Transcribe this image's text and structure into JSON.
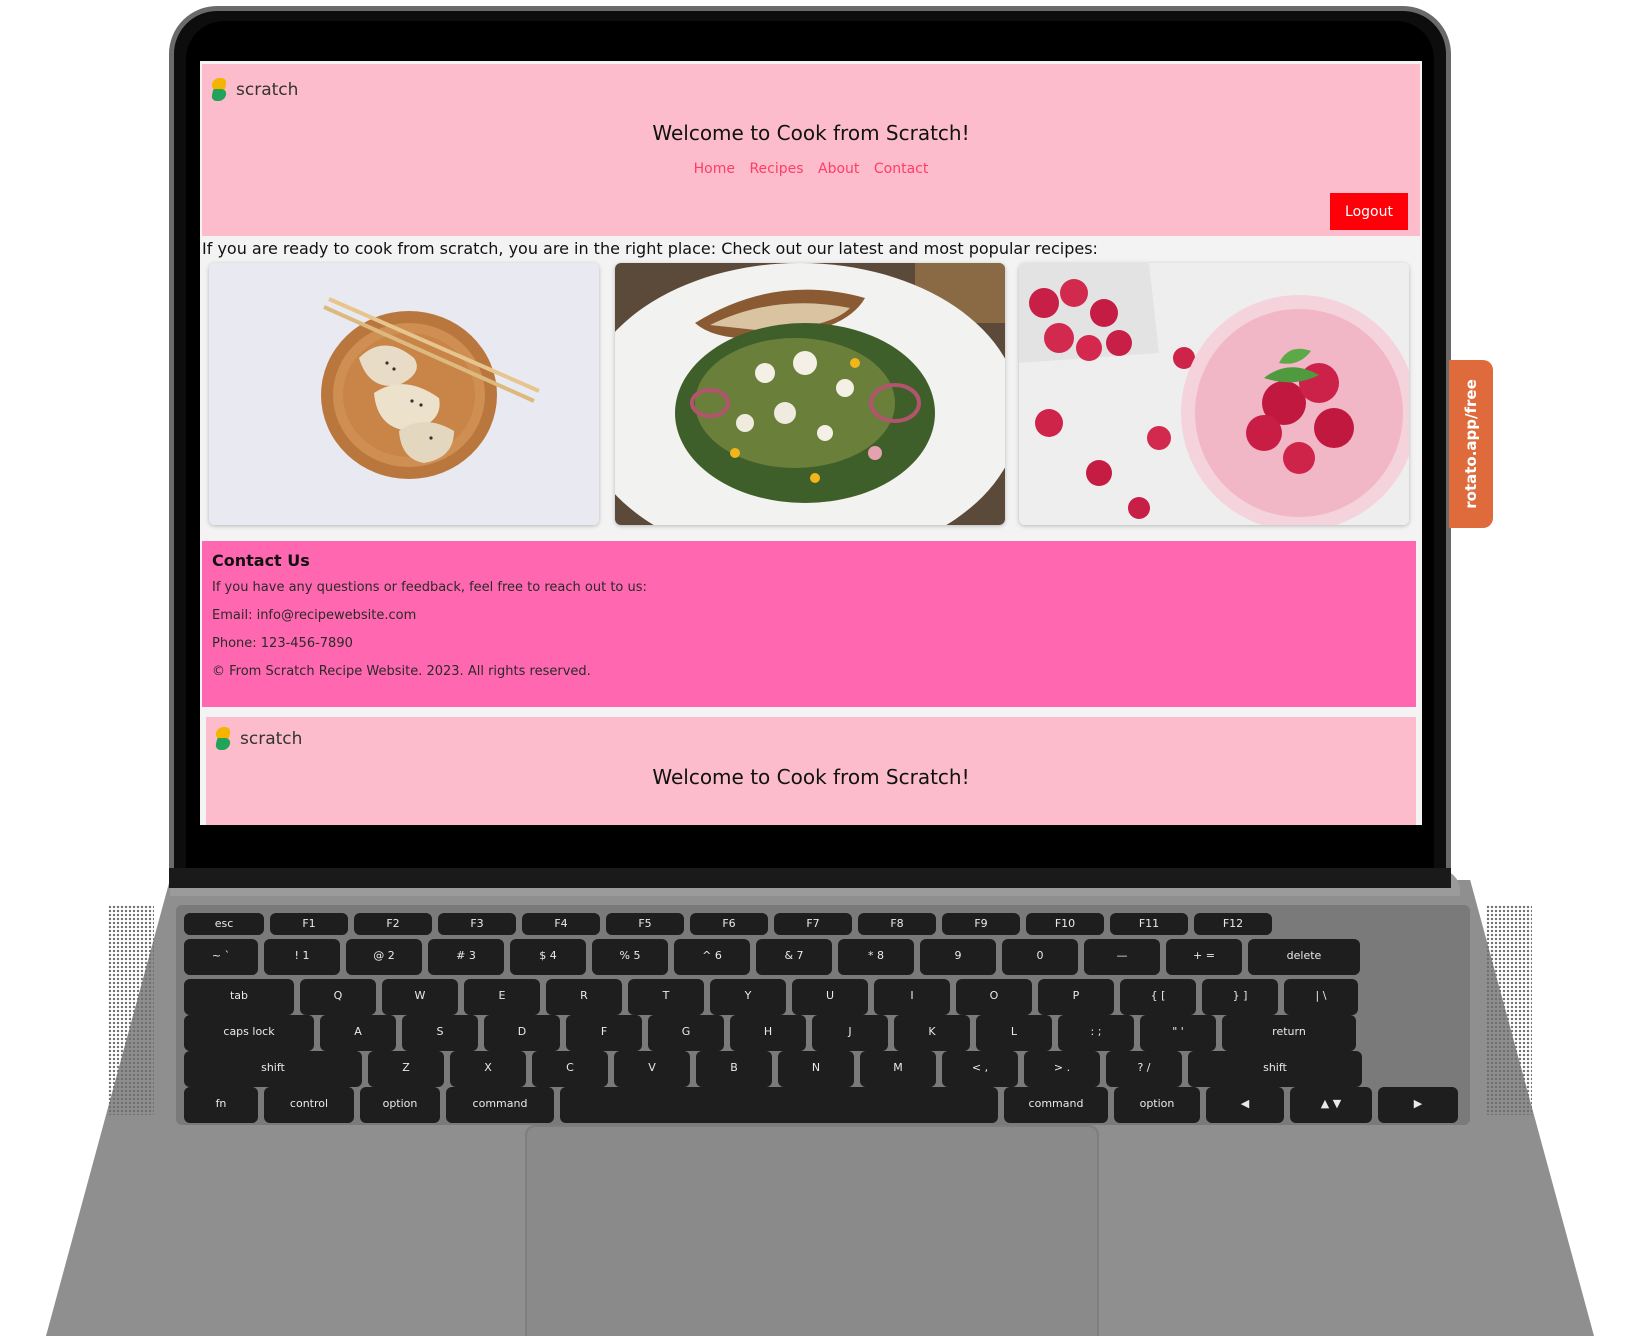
{
  "site": {
    "brand": "scratch",
    "welcome": "Welcome to Cook from Scratch!",
    "nav": [
      "Home",
      "Recipes",
      "About",
      "Contact"
    ],
    "logout": "Logout",
    "intro": "If you are ready to cook from scratch, you are in the right place: Check out our latest and most popular recipes:",
    "recipes": [
      {
        "image": "dumplings-image"
      },
      {
        "image": "salad-image"
      },
      {
        "image": "raspberry-drink-image"
      }
    ],
    "contact": {
      "heading": "Contact Us",
      "line1": "If you have any questions or feedback, feel free to reach out to us:",
      "email": "Email: info@recipewebsite.com",
      "phone": "Phone: 123-456-7890",
      "copyright": "© From Scratch Recipe Website. 2023. All rights reserved."
    },
    "footer_brand": "scratch",
    "footer_welcome": "Welcome to Cook from Scratch!"
  },
  "rotato_tag": "rotato.app/free",
  "colors": {
    "header_bg": "#fcbccb",
    "nav_link": "#ff3d67",
    "logout_bg": "#ff0008",
    "contact_bg": "#ff68b0"
  },
  "keyboard": {
    "function_row": [
      "esc",
      "F1",
      "F2",
      "F3",
      "F4",
      "F5",
      "F6",
      "F7",
      "F8",
      "F9",
      "F10",
      "F11",
      "F12"
    ],
    "number_row": [
      "~ `",
      "! 1",
      "@ 2",
      "# 3",
      "$ 4",
      "% 5",
      "^ 6",
      "& 7",
      "* 8",
      "9",
      "0",
      "—",
      "+ =",
      "delete"
    ],
    "qwerty_row": [
      "tab",
      "Q",
      "W",
      "E",
      "R",
      "T",
      "Y",
      "U",
      "I",
      "O",
      "P",
      "{ [",
      "} ]",
      "| \\"
    ],
    "home_row": [
      "caps lock",
      "A",
      "S",
      "D",
      "F",
      "G",
      "H",
      "J",
      "K",
      "L",
      ": ;",
      "\" '",
      "return"
    ],
    "shift_row": [
      "shift",
      "Z",
      "X",
      "C",
      "V",
      "B",
      "N",
      "M",
      "< ,",
      "> .",
      "? /",
      "shift"
    ],
    "bottom_row": [
      "fn",
      "control",
      "option",
      "command",
      "",
      "command",
      "option",
      "◀",
      "▲ ▼",
      "▶"
    ]
  }
}
